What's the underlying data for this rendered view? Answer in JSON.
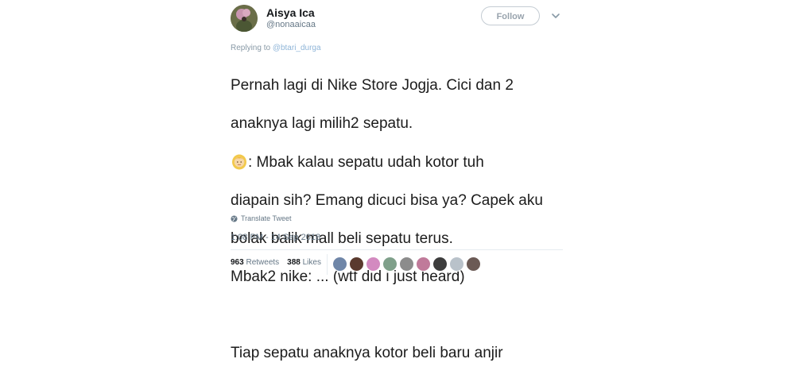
{
  "author": {
    "display_name": "Aisya Ica",
    "handle": "@nonaaicaa"
  },
  "follow_label": "Follow",
  "reply": {
    "prefix": "Replying to",
    "mention": "@btari_durga"
  },
  "tweet": {
    "line1": "Pernah lagi di Nike Store Jogja. Cici dan 2",
    "line2": "anaknya lagi milih2 sepatu.",
    "line3": ": Mbak kalau sepatu udah kotor tuh",
    "line4": "diapain sih? Emang dicuci bisa ya? Capek aku",
    "line5": "bolak balik mall beli sepatu terus.",
    "line6": "Mbak2 nike: ... (wtf did i just heard)",
    "line7": "Tiap sepatu anaknya kotor beli baru anjir",
    "emoji": "woman-blond-hair-emoji"
  },
  "translate_label": "Translate Tweet",
  "timestamp": "1:08 PM - 14 Sep 2018",
  "stats": {
    "retweets_count": "963",
    "retweets_label": "Retweets",
    "likes_count": "388",
    "likes_label": "Likes"
  },
  "likers_colors": [
    "#6f86a8",
    "#5a3a2e",
    "#d38ac0",
    "#7fa08a",
    "#8c8c8c",
    "#c07a9a",
    "#3d3d3d",
    "#b9c2ca",
    "#6b5a55"
  ],
  "colors": {
    "text": "#14171a",
    "muted": "#657786",
    "mention": "#8fb5d8"
  }
}
